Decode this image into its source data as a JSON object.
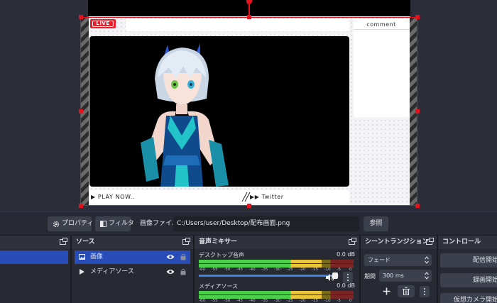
{
  "preview": {
    "live_badge": "LIVE",
    "comment_header": "comment",
    "now_playing": "▶ PLAY NOW..",
    "twitter": "▶▶ Twitter"
  },
  "toolbar": {
    "properties_label": "プロパティ",
    "filters_label": "フィルタ",
    "image_file_label": "画像ファイル",
    "image_path": "C:/Users/user/Desktop/配布画面.png",
    "browse_label": "参照"
  },
  "sources": {
    "title": "ソース",
    "items": [
      {
        "label": "画像",
        "icon": "image-icon",
        "selected": true
      },
      {
        "label": "メディアソース",
        "icon": "play-icon",
        "selected": false
      }
    ]
  },
  "mixer": {
    "title": "音声ミキサー",
    "channels": [
      {
        "name": "デスクトップ音声",
        "db": "0.0 dB",
        "level": 0.97
      },
      {
        "name": "メディアソース",
        "db": "0.0 dB",
        "level": 0.97
      }
    ],
    "ticks": [
      "-60",
      "-55",
      "-50",
      "-45",
      "-40",
      "-35",
      "-30",
      "-25",
      "-20",
      "-15",
      "-10",
      "-5",
      "0"
    ]
  },
  "transitions": {
    "title": "シーントランジション",
    "selected": "フェード",
    "duration_label": "期間",
    "duration_value": "300 ms"
  },
  "controls": {
    "title": "コントロール",
    "buttons": [
      "配信開始",
      "録画開始",
      "仮想カメラ開始"
    ]
  },
  "colors": {
    "selection": "#e3121c",
    "accent": "#284cb8",
    "live": "#e8202c"
  }
}
